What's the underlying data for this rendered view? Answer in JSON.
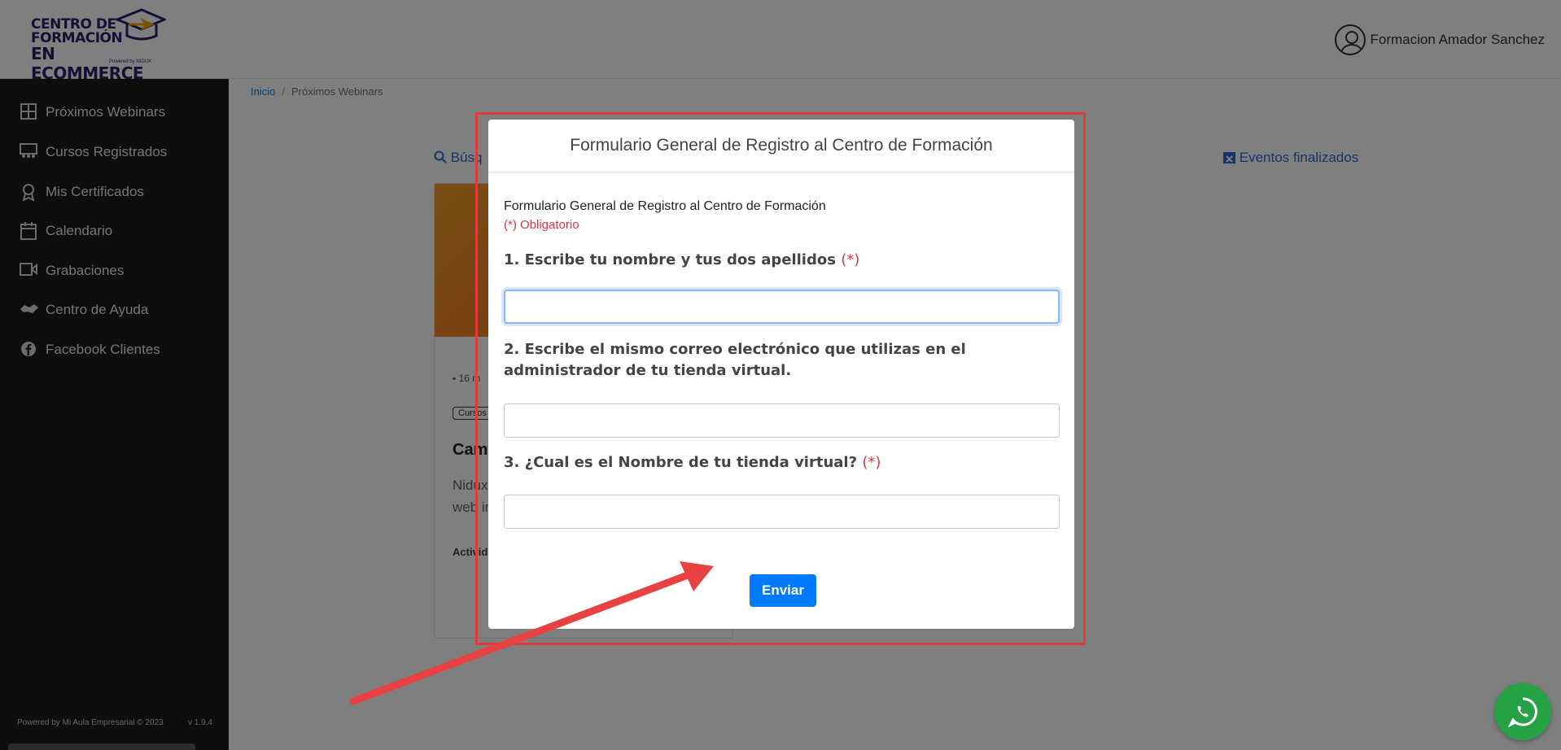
{
  "header": {
    "logo": {
      "line1": "CENTRO DE",
      "line2": "FORMACIÓN",
      "line3": "EN ECOMMERCE",
      "powered": "Powered by NIDUX"
    },
    "user_name": "Formacion Amador Sanchez"
  },
  "sidebar": {
    "items": [
      {
        "label": "Próximos Webinars",
        "icon": "grid-icon"
      },
      {
        "label": "Cursos Registrados",
        "icon": "presentation-icon"
      },
      {
        "label": "Mis Certificados",
        "icon": "certificate-icon"
      },
      {
        "label": "Calendario",
        "icon": "calendar-icon"
      },
      {
        "label": "Grabaciones",
        "icon": "video-icon"
      },
      {
        "label": "Centro de Ayuda",
        "icon": "handshake-icon"
      },
      {
        "label": "Facebook Clientes",
        "icon": "facebook-icon"
      }
    ],
    "footer": {
      "powered": "Powered by Mi Aula Empresarial © 2023",
      "version": "v 1.9.4"
    }
  },
  "breadcrumb": {
    "home": "Inicio",
    "current": "Próximos Webinars"
  },
  "background": {
    "search_label": "Búsq",
    "events_label": "Eventos finalizados",
    "card": {
      "date": "16 m",
      "tag": "Cursos",
      "title": "Cam",
      "desc_line1": "Nidux",
      "desc_line2": "web in",
      "activity": "Activid"
    }
  },
  "modal": {
    "title": "Formulario General de Registro al Centro de Formación",
    "intro": "Formulario General de Registro al Centro de Formación",
    "required_note": "(*) Obligatorio",
    "questions": [
      {
        "label": "1. Escribe tu nombre y tus dos apellidos",
        "required_mark": "(*)",
        "value": ""
      },
      {
        "label": "2. Escribe el mismo correo electrónico que utilizas en el administrador de tu tienda virtual.",
        "required_mark": "",
        "value": ""
      },
      {
        "label": "3. ¿Cual es el Nombre de tu tienda virtual?",
        "required_mark": "(*)",
        "value": ""
      }
    ],
    "submit_label": "Enviar"
  },
  "colors": {
    "primary": "#007bff",
    "required": "#dc3545",
    "highlight": "#e03a3a",
    "sidebar": "#1d1d1d",
    "whatsapp": "#25a244"
  }
}
